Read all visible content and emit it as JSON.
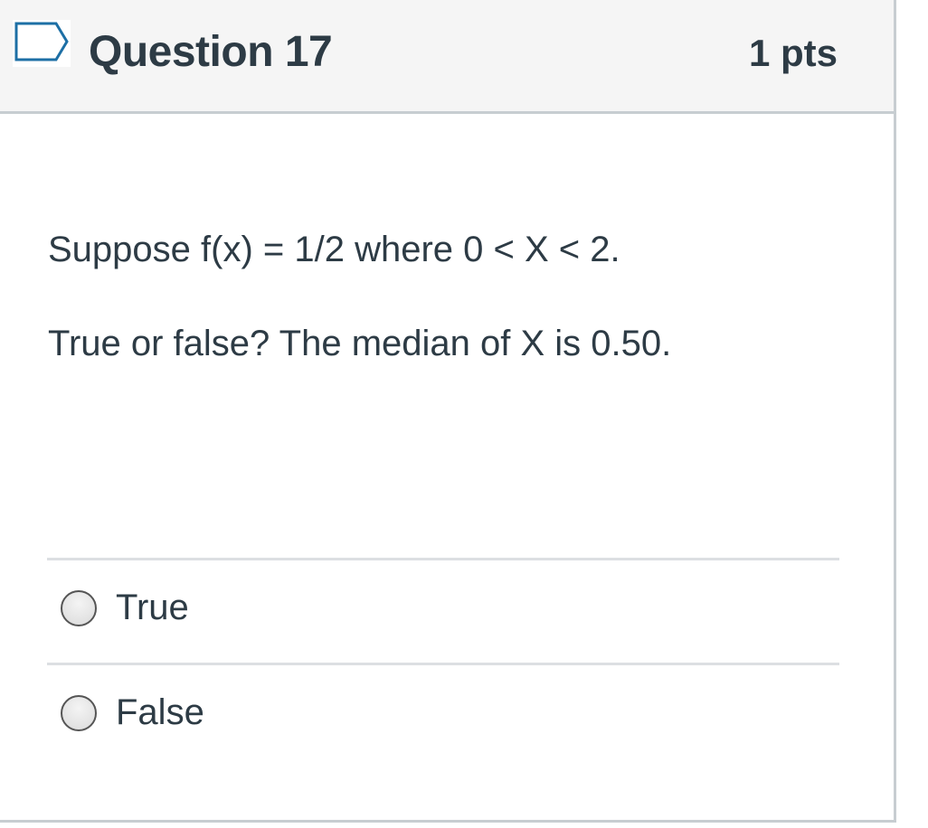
{
  "question": {
    "title": "Question 17",
    "points": "1 pts",
    "flag_icon": "bookmark-flag-icon",
    "text_lines": [
      "Suppose f(x) = 1/2 where 0 < X < 2.",
      "True or false? The median of X is 0.50."
    ]
  },
  "answers": [
    {
      "label": "True",
      "selected": false
    },
    {
      "label": "False",
      "selected": false
    }
  ],
  "colors": {
    "header_background": "#f5f5f5",
    "border": "#c7cdd1",
    "text": "#2d3b45"
  }
}
